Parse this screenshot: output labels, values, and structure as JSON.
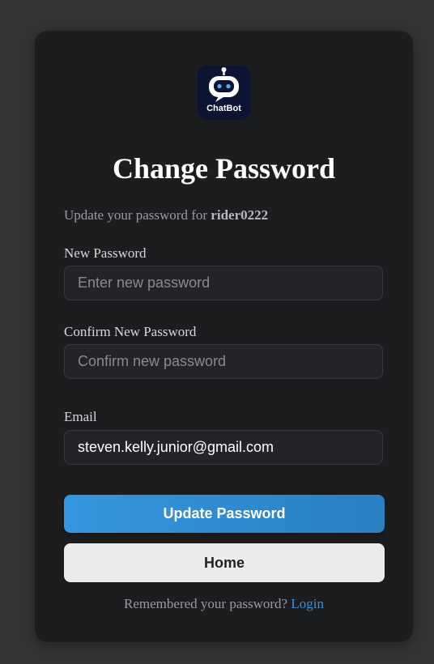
{
  "logo": {
    "text": "ChatBot",
    "icon": "robot-icon"
  },
  "page": {
    "title": "Change Password",
    "subtitle_prefix": "Update your password for ",
    "username": "rider0222"
  },
  "form": {
    "new_password": {
      "label": "New Password",
      "placeholder": "Enter new password",
      "value": ""
    },
    "confirm_password": {
      "label": "Confirm New Password",
      "placeholder": "Confirm new password",
      "value": ""
    },
    "email": {
      "label": "Email",
      "value": "steven.kelly.junior@gmail.com"
    }
  },
  "buttons": {
    "update": "Update Password",
    "home": "Home"
  },
  "footer": {
    "text": "Remembered your password? ",
    "link": "Login"
  },
  "colors": {
    "accent": "#3497df",
    "card": "#1c1d1f",
    "background": "#333436"
  }
}
